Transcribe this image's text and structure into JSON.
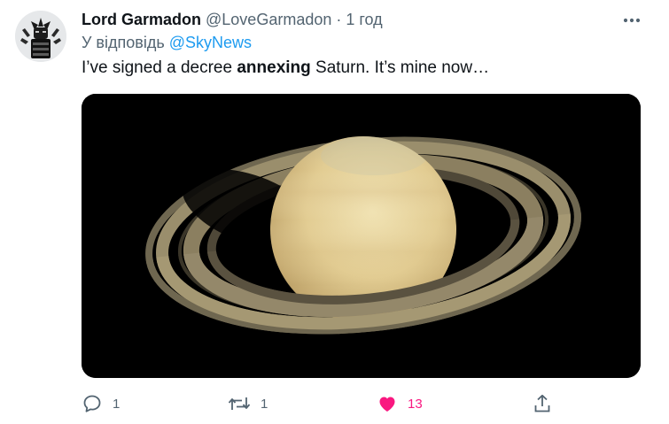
{
  "tweet": {
    "author_name": "Lord Garmadon",
    "handle": "@LoveGarmadon",
    "separator": "·",
    "time": "1 год",
    "reply_prefix": "У відповідь",
    "reply_mention": "@SkyNews",
    "text_before": "I’ve signed a decree",
    "text_bold": "annexing",
    "text_after": "Saturn. It’s mine now…",
    "image_subject": "saturn"
  },
  "actions": {
    "reply_count": "1",
    "retweet_count": "1",
    "like_count": "13",
    "liked": true
  },
  "colors": {
    "link": "#1d9bf0",
    "like": "#f91880",
    "muted": "#536471",
    "text": "#0f1419"
  },
  "icons": [
    "more-icon",
    "reply-icon",
    "retweet-icon",
    "heart-icon",
    "share-icon"
  ]
}
